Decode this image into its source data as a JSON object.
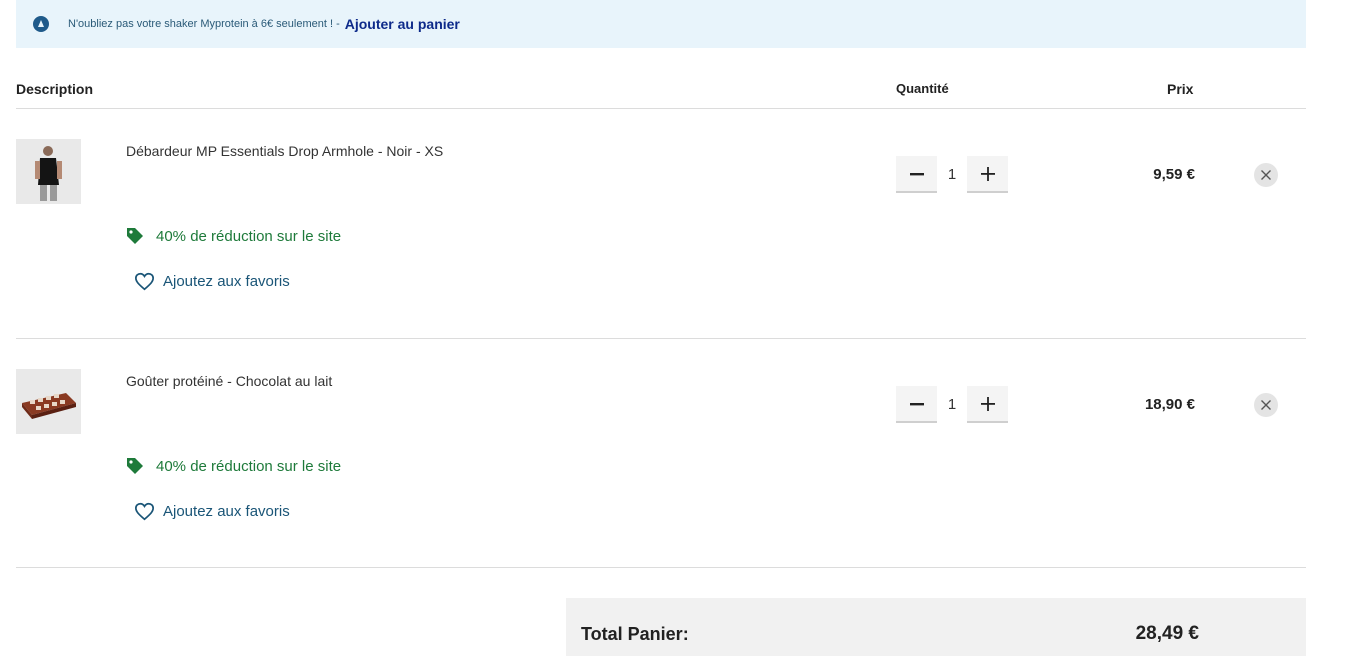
{
  "banner": {
    "icon": "info-drop-icon",
    "text": "N'oubliez pas votre shaker Myprotein à 6€ seulement ! -",
    "link": "Ajouter au panier"
  },
  "table": {
    "headers": {
      "description": "Description",
      "quantity": "Quantité",
      "price": "Prix"
    }
  },
  "items": [
    {
      "name": "Débardeur MP Essentials Drop Armhole - Noir - XS",
      "promo": "40% de réduction sur le site",
      "favorite": "Ajoutez aux favoris",
      "quantity": "1",
      "price": "9,59 €"
    },
    {
      "name": "Goûter protéiné - Chocolat au lait",
      "promo": "40% de réduction sur le site",
      "favorite": "Ajoutez aux favoris",
      "quantity": "1",
      "price": "18,90 €"
    }
  ],
  "summary": {
    "label": "Total Panier:",
    "value": "28,49 €"
  },
  "colors": {
    "banner_bg": "#e8f4fb",
    "promo_green": "#1e7a3a",
    "link_blue": "#0d2a8a"
  }
}
